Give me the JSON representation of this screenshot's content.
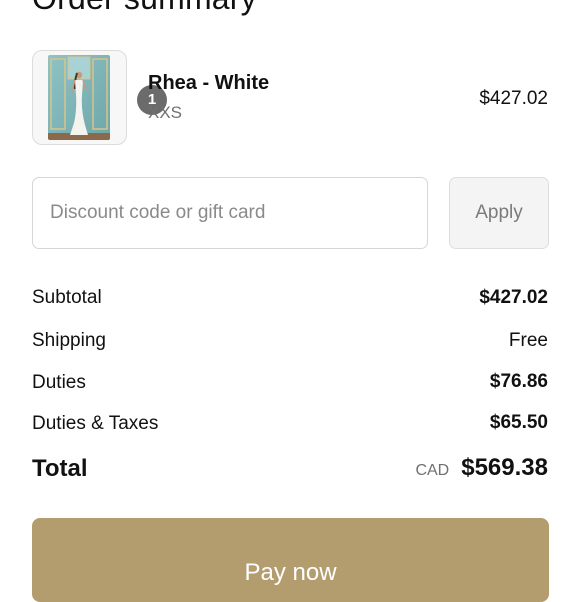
{
  "summary": {
    "heading": "Order summary"
  },
  "item": {
    "name": "Rhea - White",
    "variant": "XXS",
    "price": "$427.02",
    "quantity": "1"
  },
  "discount": {
    "placeholder": "Discount code or gift card",
    "apply_label": "Apply"
  },
  "lines": {
    "subtotal_label": "Subtotal",
    "subtotal_value": "$427.02",
    "shipping_label": "Shipping",
    "shipping_value": "Free",
    "duties_label": "Duties",
    "duties_value": "$76.86",
    "taxes_label": "Duties & Taxes",
    "taxes_value": "$65.50"
  },
  "total": {
    "label": "Total",
    "currency": "CAD",
    "amount": "$569.38"
  },
  "pay": {
    "label": "Pay now"
  },
  "colors": {
    "pay_button": "#b39d6e",
    "badge": "#6b6b6b",
    "muted_text": "#707070"
  }
}
